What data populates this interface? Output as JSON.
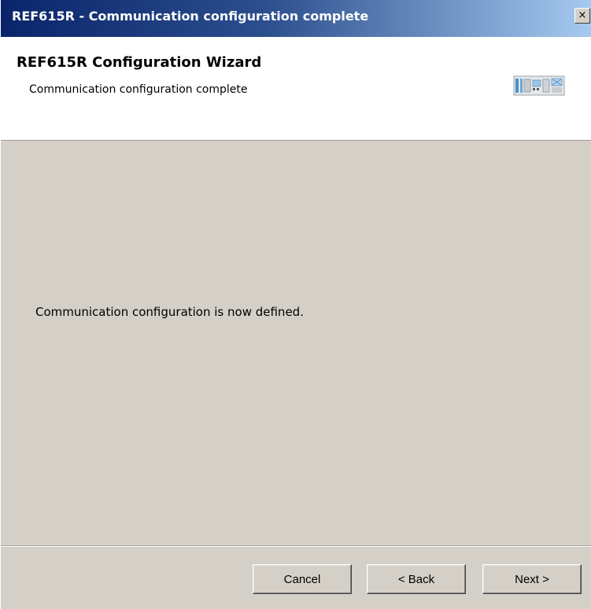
{
  "window": {
    "title": "REF615R - Communication configuration complete",
    "close_glyph": "×"
  },
  "header": {
    "title": "REF615R Configuration Wizard",
    "subtitle": "Communication configuration complete",
    "device_icon": "relay-device-icon"
  },
  "main": {
    "message": "Communication configuration is now defined."
  },
  "buttons": {
    "cancel": "Cancel",
    "back": "< Back",
    "next": "Next >"
  },
  "colors": {
    "titlebar_start": "#0a246a",
    "titlebar_end": "#a6caf0",
    "dialog_background": "#d4d0c8",
    "header_background": "#ffffff"
  }
}
